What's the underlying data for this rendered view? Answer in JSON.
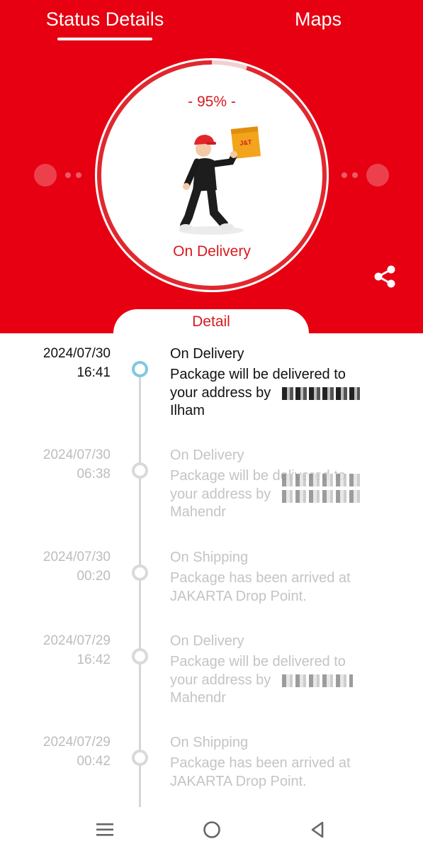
{
  "header": {
    "tabs": [
      {
        "label": "Status Details",
        "active": true
      },
      {
        "label": "Maps",
        "active": false
      }
    ]
  },
  "status_card": {
    "percent_text": "- 95% -",
    "progress": 0.95,
    "status": "On Delivery",
    "box_logo_text": "J&T"
  },
  "detail_label": "Detail",
  "timeline": [
    {
      "date": "2024/07/30",
      "time": "16:41",
      "title": "On Delivery",
      "description": "Package will be delivered to\nyour address by\nIlham",
      "active": true
    },
    {
      "date": "2024/07/30",
      "time": "06:38",
      "title": "On Delivery",
      "description": "Package will be delivered to\nyour address by\nMahendr",
      "active": false
    },
    {
      "date": "2024/07/30",
      "time": "00:20",
      "title": "On Shipping",
      "description": "Package has been arrived at\nJAKARTA Drop Point.",
      "active": false
    },
    {
      "date": "2024/07/29",
      "time": "16:42",
      "title": "On Delivery",
      "description": "Package will be delivered to\nyour address by\nMahendr",
      "active": false
    },
    {
      "date": "2024/07/29",
      "time": "00:42",
      "title": "On Shipping",
      "description": "Package has been arrived at\nJAKARTA Drop Point.",
      "active": false
    }
  ],
  "colors": {
    "brand_red": "#e60012",
    "accent_red": "#d7191f",
    "active_node": "#7fc9de",
    "inactive_text": "#c4c4c4"
  },
  "icons": {
    "share": "share-icon",
    "nav_menu": "menu-icon",
    "nav_home": "home-circle-icon",
    "nav_back": "back-triangle-icon"
  }
}
